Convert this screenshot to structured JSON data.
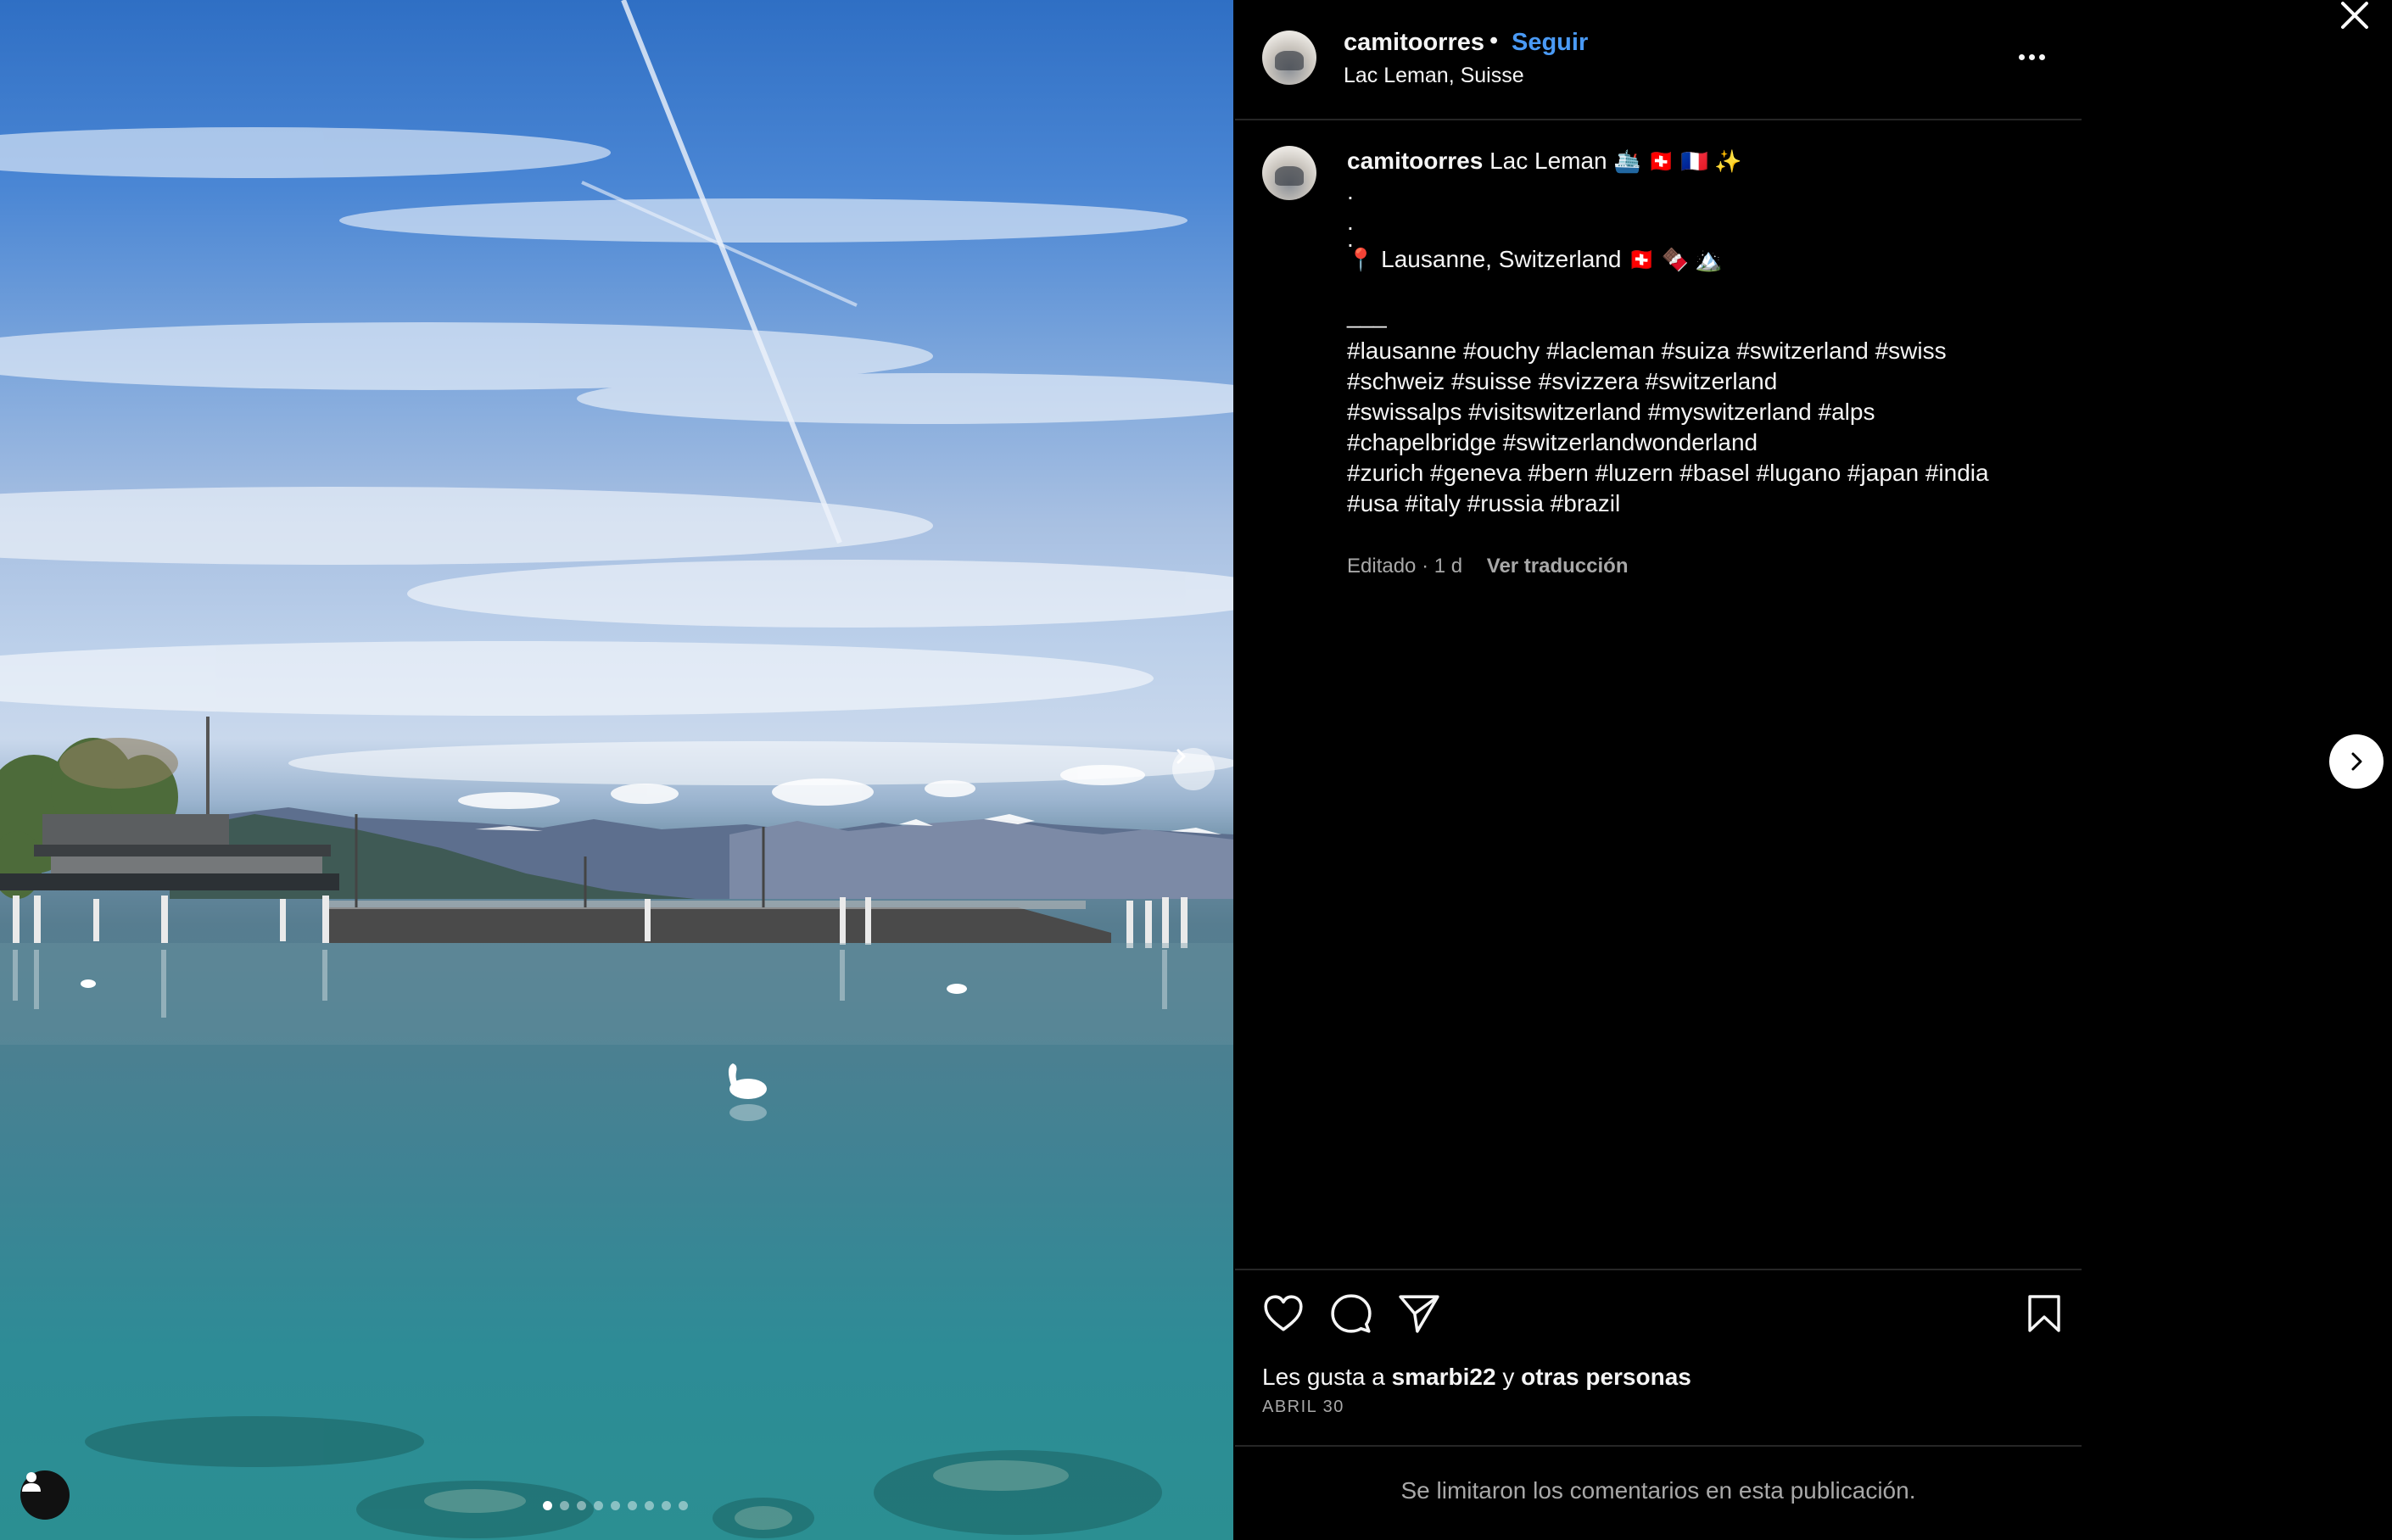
{
  "header": {
    "username": "camitoorres",
    "separator": "•",
    "follow_label": "Seguir",
    "location": "Lac Leman, Suisse"
  },
  "caption": {
    "username": "camitoorres",
    "title": "Lac Leman",
    "title_emoji": "🛳️ 🇨🇭 🇫🇷 ✨",
    "dot_lines": [
      ".",
      ".",
      "."
    ],
    "location_pin": "📍",
    "location_text": "Lausanne, Switzerland",
    "location_emoji": "🇨🇭 🍫 🏔️",
    "rule": "___",
    "hashtag_lines": [
      "#lausanne #ouchy #lacleman #suiza #switzerland #swiss",
      "#schweiz #suisse #svizzera #switzerland",
      "#swissalps #visitswitzerland #myswitzerland #alps",
      "#chapelbridge #switzerlandwonderland",
      "#zurich #geneva #bern #luzern #basel #lugano #japan #india",
      "#usa #italy #russia #brazil"
    ]
  },
  "meta": {
    "edited": "Editado · 1 d",
    "translate_label": "Ver traducción"
  },
  "likes": {
    "prefix": "Les gusta a",
    "user": "smarbi22",
    "conj": "y",
    "others": "otras personas"
  },
  "date": "ABRIL 30",
  "comments_limited": "Se limitaron los comentarios en esta publicación.",
  "carousel": {
    "total": 9,
    "active": 0
  },
  "icons": {
    "like": "heart-icon",
    "comment": "comment-bubble-icon",
    "share": "paper-plane-icon",
    "save": "bookmark-icon",
    "more": "more-dots-icon",
    "close": "close-icon",
    "next": "chevron-right-icon",
    "tagged": "user-silhouette-icon"
  },
  "colors": {
    "follow": "#4a9af5",
    "text": "#f5f5f5",
    "muted": "#a8a8a8",
    "background": "#000000",
    "divider": "#262626"
  }
}
